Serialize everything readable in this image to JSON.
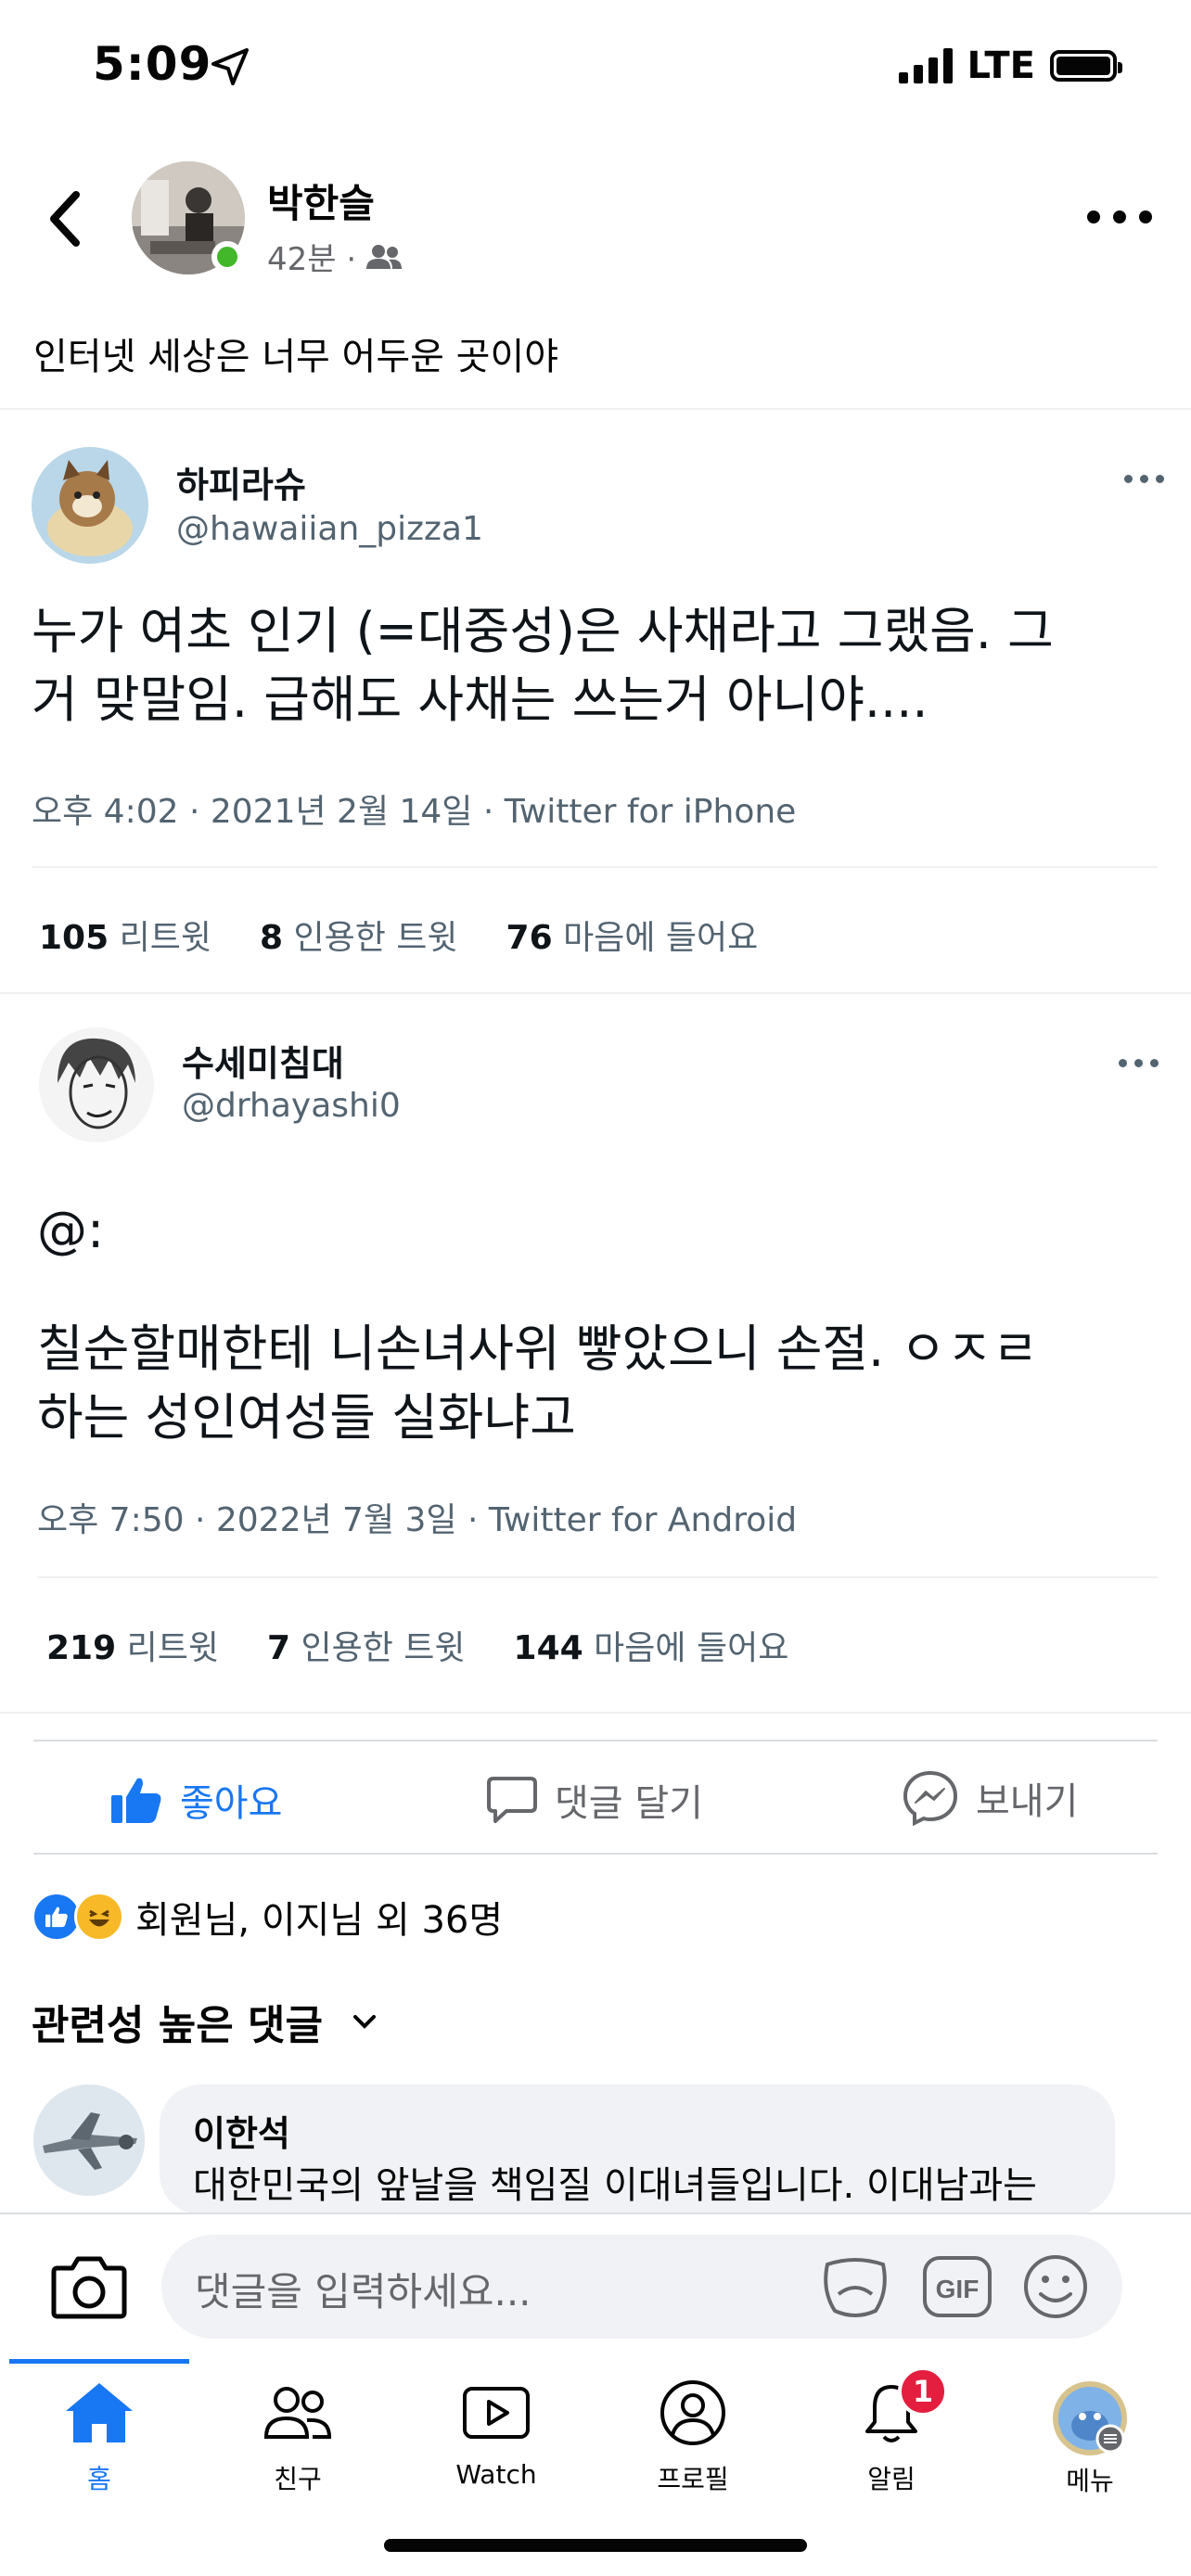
{
  "status_bar": {
    "time": "5:09",
    "network": "LTE"
  },
  "post": {
    "author": "박한슬",
    "time_ago": "42분 ·",
    "text": "인터넷 세상은 너무 어두운 곳이야"
  },
  "tweet1": {
    "name": "하피라슈",
    "handle": "@hawaiian_pizza1",
    "text_line1": "누가 여초 인기 (=대중성)은 사채라고 그랬음. 그",
    "text_line2": "거 맞말임. 급해도 사채는 쓰는거 아니야....",
    "timestamp": "오후 4:02 · 2021년 2월 14일 · Twitter for iPhone",
    "retweets_num": "105",
    "retweets_label": "리트윗",
    "quotes_num": "8",
    "quotes_label": "인용한 트윗",
    "likes_num": "76",
    "likes_label": "마음에 들어요"
  },
  "tweet2": {
    "name": "수세미침대",
    "handle": "@drhayashi0",
    "text_line0": "@:",
    "text_line1": "칠순할매한테 니손녀사위 빻았으니 손절. ㅇㅈㄹ",
    "text_line2": "하는 성인여성들 실화냐고",
    "timestamp": "오후 7:50 · 2022년 7월 3일 · Twitter for Android",
    "retweets_num": "219",
    "retweets_label": "리트윗",
    "quotes_num": "7",
    "quotes_label": "인용한 트윗",
    "likes_num": "144",
    "likes_label": "마음에 들어요"
  },
  "actions": {
    "like": "좋아요",
    "comment": "댓글 달기",
    "send": "보내기"
  },
  "reactions": {
    "summary": "회원님, 이지님 외 36명"
  },
  "comments": {
    "filter": "관련성 높은 댓글",
    "first": {
      "author": "이한석",
      "text": "대한민국의 앞날을 책임질 이대녀들입니다. 이대남과는"
    }
  },
  "composer": {
    "placeholder": "댓글을 입력하세요..."
  },
  "tabs": [
    {
      "label": "홈",
      "icon": "home-icon",
      "active": true
    },
    {
      "label": "친구",
      "icon": "friends-icon"
    },
    {
      "label": "Watch",
      "icon": "watch-icon"
    },
    {
      "label": "프로필",
      "icon": "profile-icon"
    },
    {
      "label": "알림",
      "icon": "bell-icon",
      "badge": "1"
    },
    {
      "label": "메뉴",
      "icon": "menu-avatar-icon"
    }
  ],
  "colors": {
    "accent": "#1877f2",
    "online": "#42b72a",
    "badge": "#e41e3f",
    "secondary_text": "#65676b"
  }
}
